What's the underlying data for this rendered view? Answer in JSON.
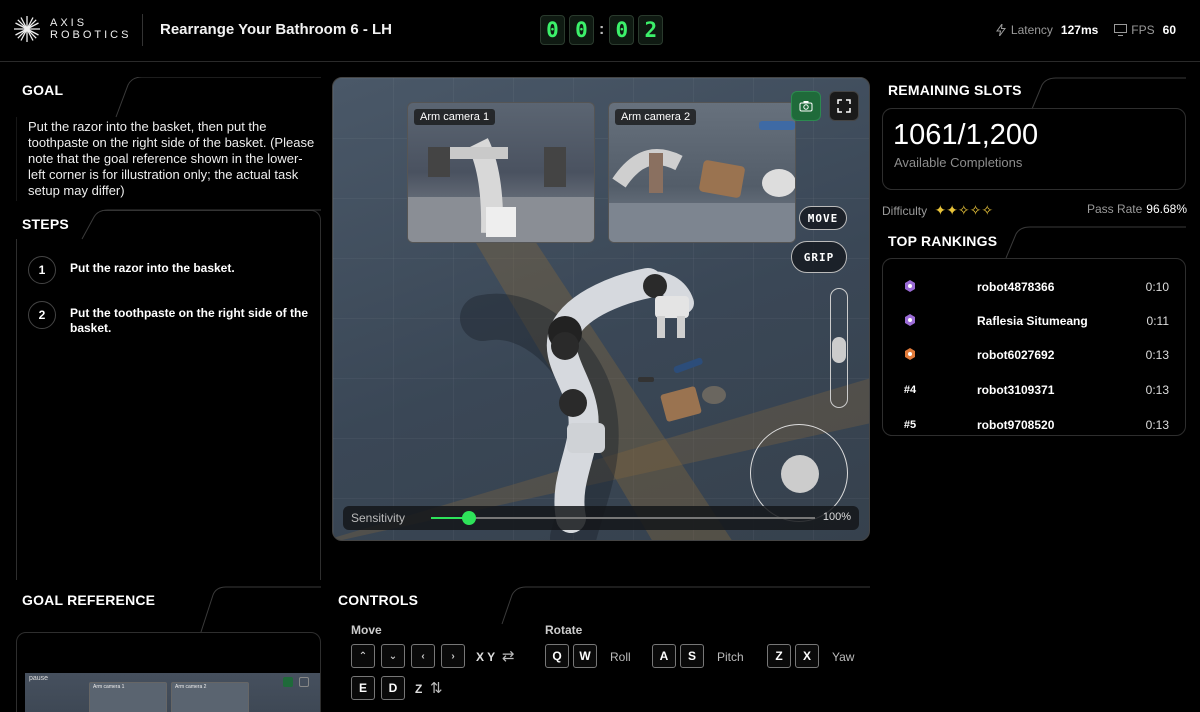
{
  "header": {
    "logo_line1": "AXIS",
    "logo_line2": "ROBOTICS",
    "task_title": "Rearrange Your Bathroom 6 - LH",
    "timer": [
      "0",
      "0",
      "0",
      "2"
    ],
    "latency_label": "Latency",
    "latency_value": "127ms",
    "fps_label": "FPS",
    "fps_value": "60"
  },
  "goal": {
    "title": "GOAL",
    "text": "Put the razor into the basket, then put the toothpaste on the right side of the basket. (Please note that the goal reference shown in the lower-left corner is for illustration only; the actual task setup may differ)"
  },
  "steps": {
    "title": "STEPS",
    "items": [
      {
        "num": "1",
        "text": "Put the razor into the basket."
      },
      {
        "num": "2",
        "text": "Put the toothpaste on the right side of the basket."
      }
    ]
  },
  "viewport": {
    "cam1_label": "Arm camera 1",
    "cam2_label": "Arm camera 2",
    "move_label": "MOVE",
    "grip_label": "GRIP",
    "sensitivity_label": "Sensitivity",
    "sensitivity_value": "100%",
    "sensitivity_fraction": 0.1,
    "icons": {
      "camera": "camera-icon",
      "fullscreen": "fullscreen-icon"
    }
  },
  "slots": {
    "title": "REMAINING SLOTS",
    "count": "1061/1,200",
    "subtitle": "Available Completions",
    "difficulty_label": "Difficulty",
    "difficulty_stars": "✦✦✧✧✧",
    "difficulty_level": 2,
    "pass_rate_label": "Pass Rate",
    "pass_rate_value": "96.68%"
  },
  "rankings": {
    "title": "TOP RANKINGS",
    "rows": [
      {
        "badge": "",
        "badge_color": "#9b6bd6",
        "name": "robot4878366",
        "time": "0:10"
      },
      {
        "badge": "",
        "badge_color": "#9b6bd6",
        "name": "Raflesia Situmeang",
        "time": "0:11"
      },
      {
        "badge": "",
        "badge_color": "#e07a3a",
        "name": "robot6027692",
        "time": "0:13"
      },
      {
        "badge": "#4",
        "badge_color": "#ffffff",
        "name": "robot3109371",
        "time": "0:13"
      },
      {
        "badge": "#5",
        "badge_color": "#ffffff",
        "name": "robot9708520",
        "time": "0:13"
      }
    ]
  },
  "goal_reference": {
    "title": "GOAL REFERENCE",
    "thumb_label": "pause",
    "thumb_cam1": "Arm camera 1",
    "thumb_cam2": "Arm camera 2"
  },
  "controls": {
    "title": "CONTROLS",
    "move_label": "Move",
    "rotate_label": "Rotate",
    "arrow_up": "⌃",
    "arrow_down": "⌄",
    "arrow_left": "‹",
    "arrow_right": "›",
    "xy_label": "X Y",
    "xy_icon": "⇄",
    "key_q": "Q",
    "key_w": "W",
    "roll_label": "Roll",
    "key_a": "A",
    "key_s": "S",
    "pitch_label": "Pitch",
    "key_z": "Z",
    "key_x": "X",
    "yaw_label": "Yaw",
    "key_e": "E",
    "key_d": "D",
    "z_label": "Z",
    "z_icon": "⇅"
  },
  "colors": {
    "accent_green": "#2ee35a",
    "timer_green": "#3cf06a",
    "star_gold": "#e8c33a"
  }
}
